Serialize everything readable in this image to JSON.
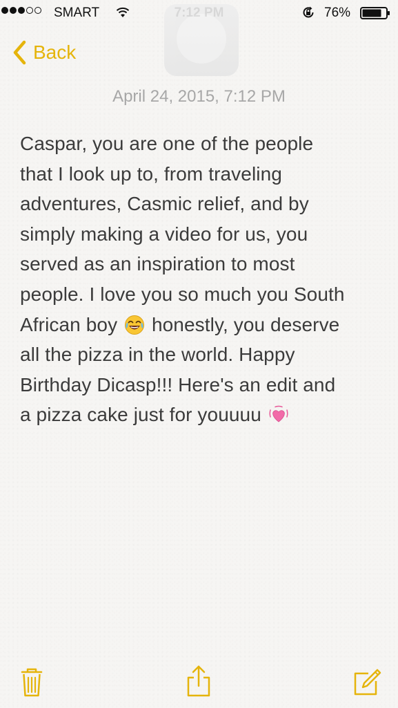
{
  "status_bar": {
    "carrier": "SMART",
    "time": "7:12 PM",
    "battery": "76%",
    "signal_bars_filled": 3,
    "signal_bars_total": 5
  },
  "nav": {
    "back_label": "Back"
  },
  "note": {
    "date": "April 24, 2015, 7:12 PM",
    "lines": [
      {
        "text": "Caspar, you are one of the people"
      },
      {
        "text": "that I look up to, from traveling"
      },
      {
        "text": "adventures, Casmic relief, and by"
      },
      {
        "text": "simply making a video for us, you"
      },
      {
        "text": "served as an inspiration to most"
      },
      {
        "text": "people. I love you so much you South"
      },
      {
        "before": "African boy",
        "emoji": "joy-emoji",
        "after": "honestly, you deserve"
      },
      {
        "text": "all the pizza in the world. Happy"
      },
      {
        "text": "Birthday Dicasp!!! Here's an edit and"
      },
      {
        "before": "a pizza cake just for youuuu",
        "emoji": "vibrating-heart-emoji",
        "after": ""
      }
    ]
  },
  "toolbar": {
    "icons": [
      "trash-icon",
      "share-icon",
      "compose-icon"
    ]
  },
  "colors": {
    "accent": "#e5b40b",
    "text": "#3b3b3b",
    "date": "#a7a7a7",
    "background": "#f6f5f3"
  }
}
